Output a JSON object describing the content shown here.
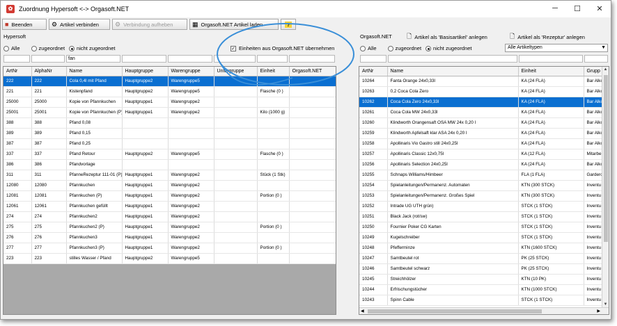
{
  "window": {
    "title": "Zuordnung Hypersoft <-> Orgasoft.NET"
  },
  "toolbar": {
    "beenden": "Beenden",
    "artikel_verbinden": "Artikel verbinden",
    "verbindung_aufheben": "Verbindung aufheben",
    "orgasoft_laden": "Orgasoft.NET Artikel laden"
  },
  "left": {
    "section_title": "Hypersoft",
    "radio_all": "Alle",
    "radio_assigned": "zugeordnet",
    "radio_unassigned": "nicht zugeordnet",
    "checkbox_units": "Einheiten aus Orgasoft.NET übernehmen",
    "filter_name": "fan",
    "columns": [
      "ArtNr",
      "AlphaNr",
      "Name",
      "Hauptgruppe",
      "Warengruppe",
      "Untergruppe",
      "Einheit",
      "Orgasoft.NET"
    ],
    "rows": [
      [
        "222",
        "222",
        "Cola 0,4l mit Pfand",
        "Hauptgruppe2",
        "Warengruppe5",
        "",
        "",
        ""
      ],
      [
        "221",
        "221",
        "Kistenpfand",
        "Hauptgruppe2",
        "Warengruppe5",
        "",
        "Flasche (0 )",
        ""
      ],
      [
        "25000",
        "25000",
        "Kopie von Pfannkuchen",
        "Hauptgruppe1",
        "Warengruppe2",
        "",
        "",
        ""
      ],
      [
        "25001",
        "25001",
        "Kopie von Pfannkuchen (P)",
        "Hauptgruppe1",
        "Warengruppe2",
        "",
        "Kilo (1000 g)",
        ""
      ],
      [
        "388",
        "388",
        "Pfand 0,08",
        "",
        "",
        "",
        "",
        ""
      ],
      [
        "389",
        "389",
        "Pfand 0,15",
        "",
        "",
        "",
        "",
        ""
      ],
      [
        "387",
        "387",
        "Pfand 0,25",
        "",
        "",
        "",
        "",
        ""
      ],
      [
        "337",
        "337",
        "Pfand Retour",
        "Hauptgruppe2",
        "Warengruppe5",
        "",
        "Flasche (0 )",
        ""
      ],
      [
        "386",
        "386",
        "Pfandvorlage",
        "",
        "",
        "",
        "",
        ""
      ],
      [
        "311",
        "311",
        "PfanneRezeptur 111-01 (P)",
        "Hauptgruppe1",
        "Warengruppe2",
        "",
        "Stück (1 Stk)",
        ""
      ],
      [
        "12080",
        "12080",
        "Pfannkuchen",
        "Hauptgruppe1",
        "Warengruppe2",
        "",
        "",
        ""
      ],
      [
        "12081",
        "12081",
        "Pfannkuchen (P)",
        "Hauptgruppe1",
        "Warengruppe2",
        "",
        "Portion (0 )",
        ""
      ],
      [
        "12061",
        "12061",
        "Pfannkuchen gefüllt",
        "Hauptgruppe1",
        "Warengruppe2",
        "",
        "",
        ""
      ],
      [
        "274",
        "274",
        "Pfannkuchen2",
        "Hauptgruppe1",
        "Warengruppe2",
        "",
        "",
        ""
      ],
      [
        "275",
        "275",
        "Pfannkuchen2 (P)",
        "Hauptgruppe1",
        "Warengruppe2",
        "",
        "Portion (0 )",
        ""
      ],
      [
        "276",
        "276",
        "Pfannkuchen3",
        "Hauptgruppe1",
        "Warengruppe2",
        "",
        "",
        ""
      ],
      [
        "277",
        "277",
        "Pfannkuchen3 (P)",
        "Hauptgruppe1",
        "Warengruppe2",
        "",
        "Portion (0 )",
        ""
      ],
      [
        "223",
        "223",
        "stilles Wasser / Pfand",
        "Hauptgruppe2",
        "Warengruppe5",
        "",
        "",
        ""
      ]
    ]
  },
  "right": {
    "section_title": "Orgasoft.NET",
    "btn_basis": "Artikel als 'Basisartikel' anlegen",
    "btn_rezeptur": "Artikel als 'Rezeptur' anlegen",
    "radio_all": "Alle",
    "radio_assigned": "zugeordnet",
    "radio_unassigned": "nicht zugeordnet",
    "select_type": "Alle Artikeltypen",
    "columns": [
      "ArtNr",
      "Name",
      "Einheit",
      "Grupp"
    ],
    "rows": [
      [
        "10264",
        "Fanta Orange 24x0,33l",
        "KA (24 FLA)",
        "Bar Alko"
      ],
      [
        "10263",
        "0,2 Coca Cola Zero",
        "KA (24 FLA)",
        "Bar Alko"
      ],
      [
        "10262",
        "Coca Cola Zero 24x0,33l",
        "KA (24 FLA)",
        "Bar Alko"
      ],
      [
        "10261",
        "Coca Cola MW 24x0,33l",
        "KA (24 FLA)",
        "Bar Alko"
      ],
      [
        "10260",
        "Klindworth Orangensaft OSA MW 24x 0,20 l",
        "KA (24 FLA)",
        "Bar Alko"
      ],
      [
        "10259",
        "Klindworth Apfelsaft klar ASA 24x 0,20 l",
        "KA (24 FLA)",
        "Bar Alko"
      ],
      [
        "10258",
        "Apollinaris Vio Gastro still 24x0,25l",
        "KA (24 FLA)",
        "Bar Alko"
      ],
      [
        "10257",
        "Apollinaris Classic 12x0,75l",
        "KA (12 FLA)",
        "Mitarbe"
      ],
      [
        "10256",
        "Apollinaris Selection 24x0,25l",
        "KA (24 FLA)",
        "Bar Alko"
      ],
      [
        "10255",
        "Schnaps Williams/Himbeer",
        "FLA (1 FLA)",
        "Gardero"
      ],
      [
        "10254",
        "Spielanleitungen/Permanenz. Automaten",
        "KTN (300 STCK)",
        "Inventu"
      ],
      [
        "10253",
        "Spielanleitungen/Permanenz. Großes Spiel",
        "KTN (300 STCK)",
        "Inventu"
      ],
      [
        "10252",
        "Intrade UG UTH grün)",
        "STCK (1 STCK)",
        "Inventu"
      ],
      [
        "10251",
        "Black Jack (rot/sw)",
        "STCK (1 STCK)",
        "Inventu"
      ],
      [
        "10250",
        "Fournier Poker CG Karten",
        "STCK (1 STCK)",
        "Inventu"
      ],
      [
        "10249",
        "Kugelschreiber",
        "STCK (1 STCK)",
        "Inventu"
      ],
      [
        "10248",
        "Pfefferminze",
        "KTN (1600 STCK)",
        "Inventu"
      ],
      [
        "10247",
        "Samtbeutel rot",
        "PK (25 STCK)",
        "Inventu"
      ],
      [
        "10246",
        "Samtbeutel schwarz",
        "PK (25 STCK)",
        "Inventu"
      ],
      [
        "10245",
        "Streichhölzer",
        "KTN (10 PK)",
        "Inventu"
      ],
      [
        "10244",
        "Erfrischungstücher",
        "KTN (1000 STCK)",
        "Inventu"
      ],
      [
        "10243",
        "Spinn Cable",
        "STCK (1 STCK)",
        "Inventu"
      ]
    ]
  },
  "colors": {
    "selection": "#0a6fd1",
    "annotation": "#3a8fd8",
    "titlebar_icon": "#d23a32"
  }
}
